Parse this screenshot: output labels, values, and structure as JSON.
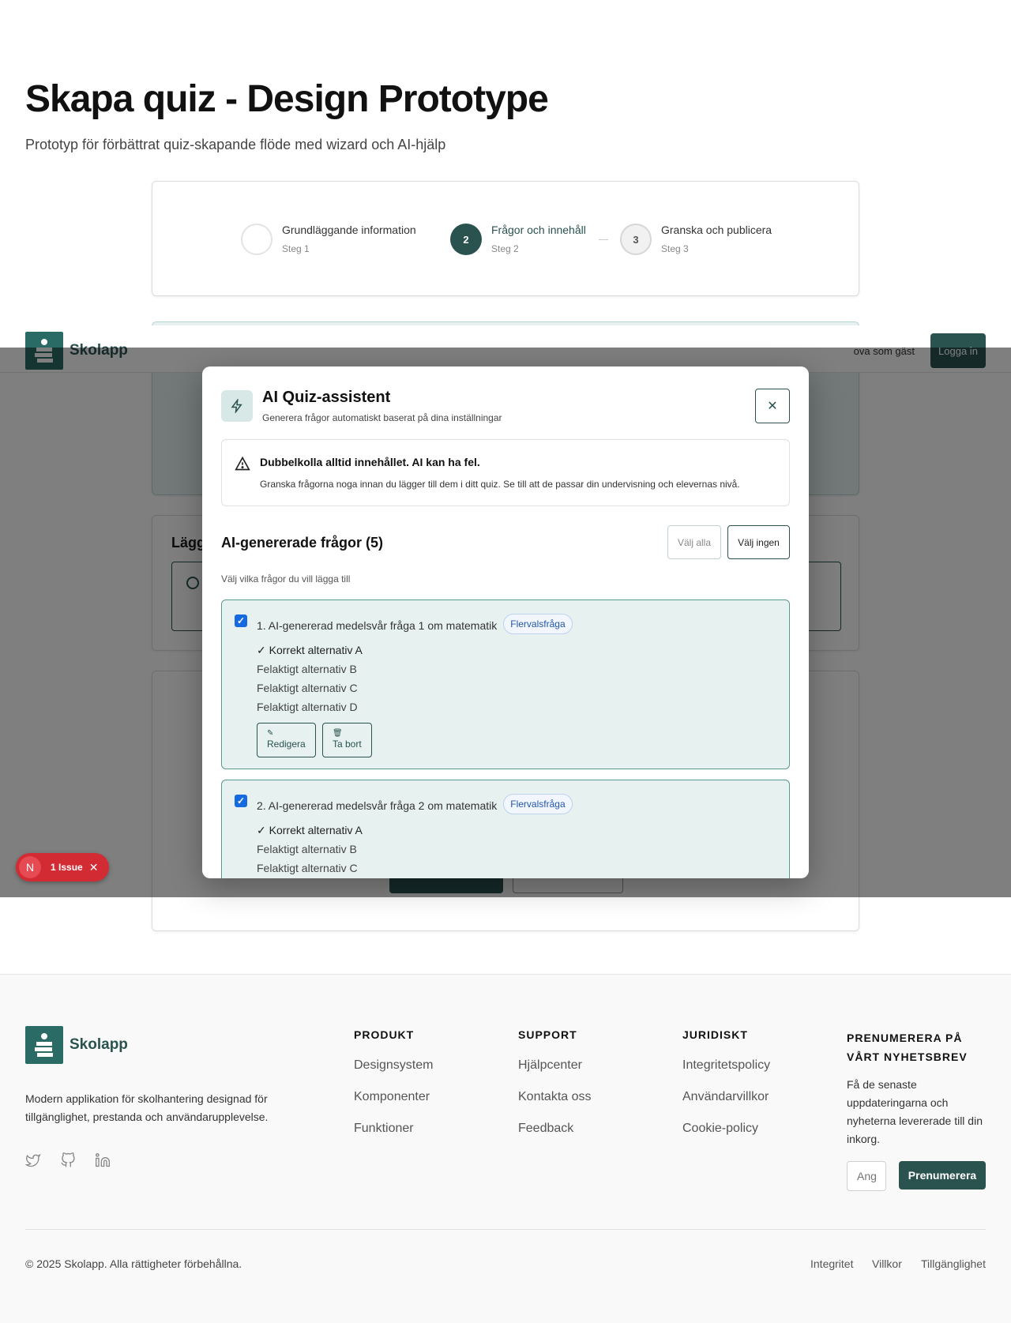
{
  "page": {
    "title": "Skapa quiz - Design Prototype",
    "subtitle": "Prototyp för förbättrat quiz-skapande flöde med wizard och AI-hjälp"
  },
  "stepper": {
    "steps": [
      {
        "number": "",
        "title": "Grundläggande information",
        "sub": "Steg 1",
        "state": "done"
      },
      {
        "number": "2",
        "title": "Frågor och innehåll",
        "sub": "Steg 2",
        "state": "active"
      },
      {
        "number": "3",
        "title": "Granska och publicera",
        "sub": "Steg 3",
        "state": "todo"
      }
    ]
  },
  "background": {
    "add_card_title": "Lägg"
  },
  "navbar": {
    "brand": "Skolapp",
    "guest": "ova som gäst",
    "login": "Logga in"
  },
  "modal": {
    "title": "AI Quiz-assistent",
    "subtitle": "Generera frågor automatiskt baserat på dina inställningar",
    "close_icon": "close-icon",
    "warning": {
      "title": "Dubbelkolla alltid innehållet. AI kan ha fel.",
      "text": "Granska frågorna noga innan du lägger till dem i ditt quiz. Se till att de passar din undervisning och elevernas nivå."
    },
    "questions_heading": "AI-genererade frågor (5)",
    "select_all": "Välj alla",
    "select_none": "Välj ingen",
    "hint": "Välj vilka frågor du vill lägga till",
    "questions": [
      {
        "title": "1. AI-genererad medelsvår fråga 1 om matematik",
        "type": "Flervalsfråga",
        "checked": true,
        "options": [
          "✓ Korrekt alternativ A",
          "Felaktigt alternativ B",
          "Felaktigt alternativ C",
          "Felaktigt alternativ D"
        ],
        "edit": "Redigera",
        "delete": "Ta bort"
      },
      {
        "title": "2. AI-genererad medelsvår fråga 2 om matematik",
        "type": "Flervalsfråga",
        "checked": true,
        "options": [
          "✓ Korrekt alternativ A",
          "Felaktigt alternativ B",
          "Felaktigt alternativ C"
        ]
      }
    ]
  },
  "issue_badge": {
    "letter": "N",
    "label": "1 Issue"
  },
  "footer": {
    "brand": "Skolapp",
    "description": "Modern applikation för skolhantering designad för tillgänglighet, prestanda och användarupplevelse.",
    "social_icons": [
      "twitter-icon",
      "github-icon",
      "linkedin-icon"
    ],
    "columns": [
      {
        "title": "PRODUKT",
        "links": [
          "Designsystem",
          "Komponenter",
          "Funktioner"
        ]
      },
      {
        "title": "SUPPORT",
        "links": [
          "Hjälpcenter",
          "Kontakta oss",
          "Feedback"
        ]
      },
      {
        "title": "JURIDISKT",
        "links": [
          "Integritetspolicy",
          "Användarvillkor",
          "Cookie-policy"
        ]
      }
    ],
    "newsletter": {
      "title": "PRENUMERERA PÅ VÅRT NYHETSBREV",
      "text": "Få de senaste uppdateringarna och nyheterna levererade till din inkorg.",
      "placeholder": "Ang",
      "button": "Prenumerera"
    },
    "copyright": "© 2025 Skolapp. Alla rättigheter förbehållna.",
    "legal_links": [
      "Integritet",
      "Villkor",
      "Tillgänglighet"
    ]
  },
  "colors": {
    "primary": "#2a5350",
    "accent_bg": "#e6f1f0",
    "checkbox": "#1769e0",
    "issue_red": "#d22b34"
  }
}
